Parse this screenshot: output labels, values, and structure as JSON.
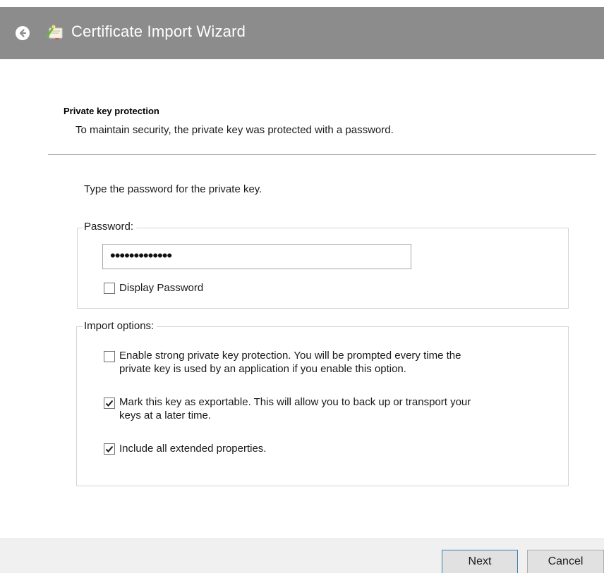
{
  "window": {
    "title": "Certificate Import Wizard",
    "back_icon": "back-arrow-icon",
    "app_icon": "certificate-wizard-icon"
  },
  "header": {
    "heading": "Private key protection",
    "description": "To maintain security, the private key was protected with a password."
  },
  "body": {
    "prompt": "Type the password for the private key."
  },
  "password_group": {
    "label": "Password:",
    "value": "•••••••••••••",
    "display_password": {
      "label": "Display Password",
      "checked": false
    }
  },
  "import_options": {
    "label": "Import options:",
    "options": [
      {
        "line1": "Enable strong private key protection. You will be prompted every time the",
        "line2": "private key is used by an application if you enable this option.",
        "checked": false
      },
      {
        "line1": "Mark this key as exportable. This will allow you to back up or transport your",
        "line2": "keys at a later time.",
        "checked": true
      },
      {
        "line1": "Include all extended properties.",
        "checked": true
      }
    ]
  },
  "footer": {
    "next_label": "Next",
    "cancel_label": "Cancel"
  },
  "colors": {
    "titlebar": "#8c8c8c",
    "footer": "#f0f0f0",
    "button_face": "#e1e1e1",
    "default_button_border": "#3c7fb1"
  }
}
